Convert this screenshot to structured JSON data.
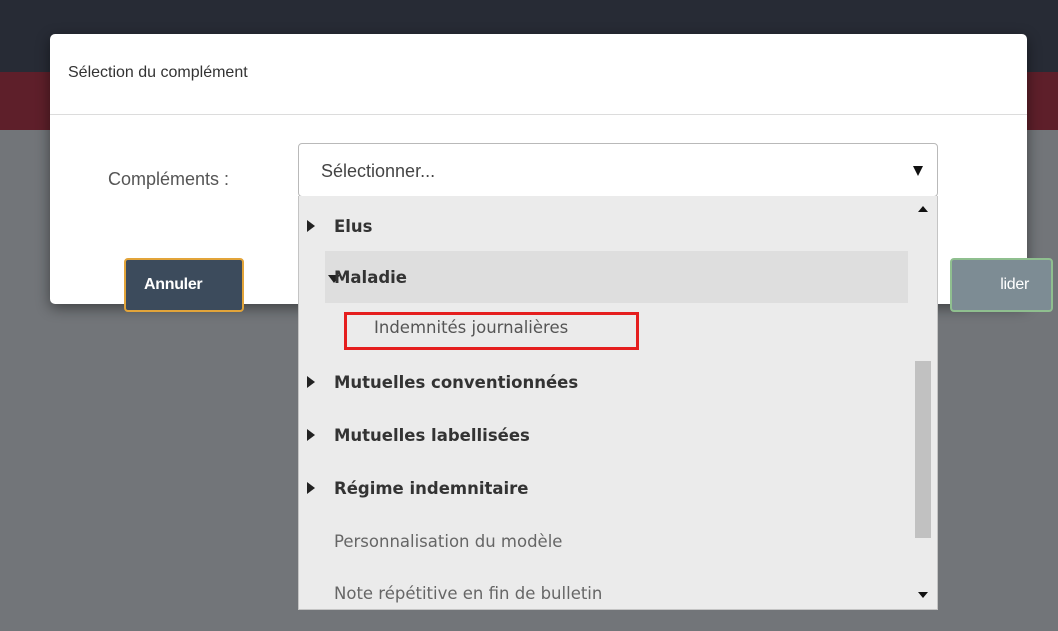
{
  "modal": {
    "title": "Sélection du complément",
    "field_label": "Compléments :",
    "cancel_label": "Annuler",
    "validate_label_visible": "lider"
  },
  "select": {
    "value": "Sélectionner...",
    "caret_icon": "caret-down-icon"
  },
  "dropdown": {
    "items": [
      {
        "label": "Elus",
        "type": "group",
        "expanded": false
      },
      {
        "label": "Maladie",
        "type": "group",
        "expanded": true
      },
      {
        "label": "Indemnités journalières",
        "type": "child",
        "highlighted": true
      },
      {
        "label": "Mutuelles conventionnées",
        "type": "group",
        "expanded": false
      },
      {
        "label": "Mutuelles labellisées",
        "type": "group",
        "expanded": false
      },
      {
        "label": "Régime indemnitaire",
        "type": "group",
        "expanded": false
      },
      {
        "label": "Personnalisation du modèle",
        "type": "option"
      },
      {
        "label": "Note répétitive en fin de bulletin",
        "type": "option"
      }
    ],
    "highlight_color": "#e51e1e",
    "hover_item": "Maladie"
  },
  "colors": {
    "overlay": "#727579",
    "topbar": "#272b35",
    "brand_bar": "#5e1f2a",
    "cancel_button": "#3c4b5c",
    "cancel_border": "#e2a43a",
    "validate_button": "#7d8c94"
  }
}
